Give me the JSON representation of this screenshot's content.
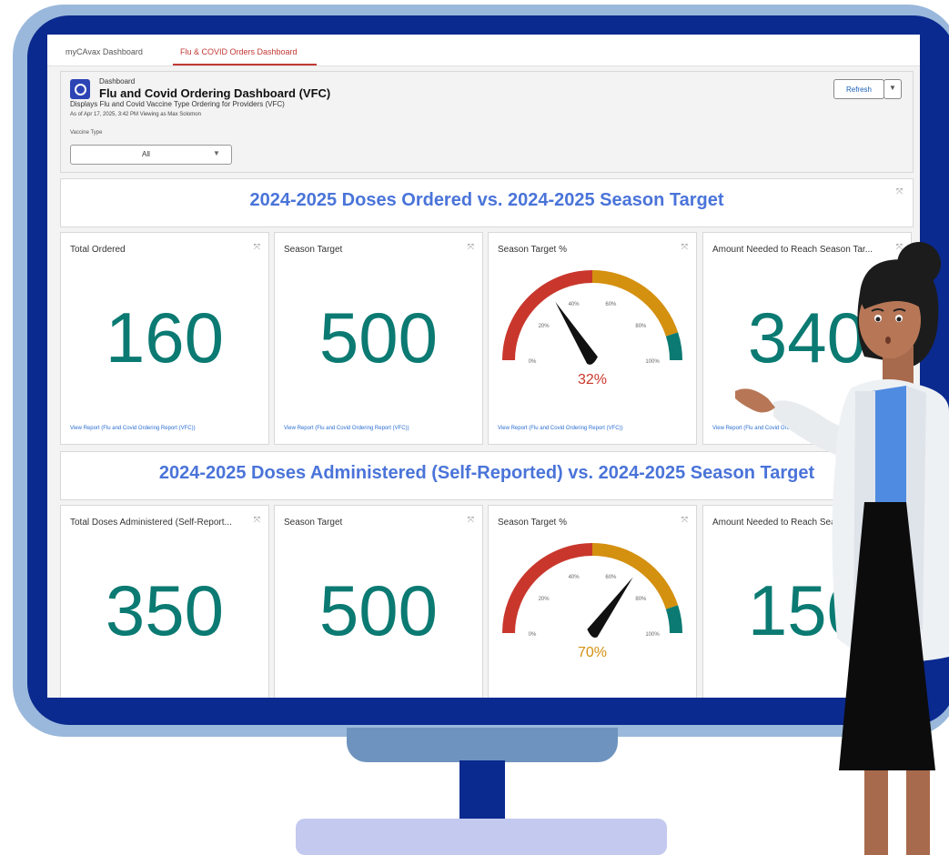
{
  "tabs": [
    {
      "label": "myCAvax Dashboard"
    },
    {
      "label": "Flu & COVID Orders Dashboard"
    }
  ],
  "header": {
    "kicker": "Dashboard",
    "title": "Flu and Covid Ordering Dashboard (VFC)",
    "subtitle": "Displays Flu and Covid Vaccine Type Ordering for Providers (VFC)",
    "as_of": "As of Apr 17, 2025, 3:42 PM Viewing as Max Solomon",
    "filter_label": "Vaccine Type",
    "filter_value": "All",
    "refresh_label": "Refresh"
  },
  "section1": {
    "title": "2024-2025 Doses Ordered vs. 2024-2025 Season Target",
    "cards": [
      {
        "title": "Total Ordered",
        "value": "160",
        "link": "View Report (Flu and Covid Ordering Report (VFC))"
      },
      {
        "title": "Season Target",
        "value": "500",
        "link": "View Report (Flu and Covid Ordering Report (VFC))"
      },
      {
        "title": "Season Target %",
        "gauge_value": 32,
        "gauge_label": "32%",
        "link": "View Report (Flu and Covid Ordering Report (VFC))"
      },
      {
        "title": "Amount Needed to Reach Season Tar...",
        "value": "340",
        "link": "View Report (Flu and Covid Ordering Report (VFC))"
      }
    ]
  },
  "section2": {
    "title": "2024-2025 Doses Administered (Self-Reported) vs. 2024-2025 Season Target",
    "cards": [
      {
        "title": "Total Doses Administered (Self-Report...",
        "value": "350"
      },
      {
        "title": "Season Target",
        "value": "500"
      },
      {
        "title": "Season Target %",
        "gauge_value": 70,
        "gauge_label": "70%"
      },
      {
        "title": "Amount Needed to Reach Season Tar...",
        "value": "150"
      }
    ]
  },
  "gauge": {
    "ticks": [
      "0%",
      "20%",
      "40%",
      "60%",
      "80%",
      "100%"
    ],
    "colors": {
      "red": "#c9372c",
      "orange": "#d4900f",
      "teal": "#0b7a72"
    }
  },
  "colors": {
    "accent": "#4a74d9",
    "metric": "#0b7a72",
    "tab_active": "#c23934"
  }
}
